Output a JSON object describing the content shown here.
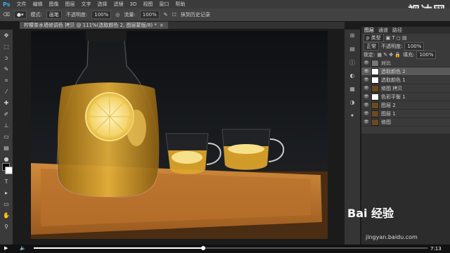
{
  "app": {
    "logo": "Ps"
  },
  "menu": [
    "文件",
    "编辑",
    "图像",
    "图层",
    "文字",
    "选择",
    "滤镜",
    "3D",
    "视图",
    "窗口",
    "帮助"
  ],
  "watermark_top": "视达网",
  "options": {
    "mode_label": "模式:",
    "mode_value": "画笔",
    "opacity_label": "不透明度:",
    "opacity_value": "100%",
    "flow_label": "流量:",
    "flow_value": "100%",
    "erase_history": "抹到历史记录"
  },
  "document_tab": {
    "title": "柠檬茶水墙修调色 拷贝 @ 111%(选取颜色 2, 图层蒙版/8) *",
    "close": "×"
  },
  "panel": {
    "tabs": [
      "图层",
      "通道",
      "路径"
    ],
    "active_tab": 0,
    "filter_label": "p 类型",
    "blend_mode": "正常",
    "opacity_label": "不透明度:",
    "opacity_value": "100%",
    "lock_label": "锁定:",
    "fill_label": "填充:",
    "fill_value": "100%",
    "layers": [
      {
        "name": "对比",
        "kind": "group",
        "selected": false
      },
      {
        "name": "选取颜色 2",
        "kind": "adj",
        "selected": true
      },
      {
        "name": "选取颜色 1",
        "kind": "adj",
        "selected": false
      },
      {
        "name": "修图 拷贝",
        "kind": "pixel",
        "selected": false
      },
      {
        "name": "色彩平衡 1",
        "kind": "adj",
        "selected": false
      },
      {
        "name": "图层 2",
        "kind": "pixel",
        "selected": false
      },
      {
        "name": "图层 1",
        "kind": "pixel",
        "selected": false
      },
      {
        "name": "修图",
        "kind": "pixel",
        "selected": false
      }
    ]
  },
  "player": {
    "time": "7:13",
    "progress": 0.43
  },
  "watermark_bottom": "Bai 经验",
  "watermark_url": "jingyan.baidu.com",
  "colors": {
    "accent": "#3fa9f5",
    "tray": "#c07a2e",
    "tea": "#e8a21e"
  }
}
